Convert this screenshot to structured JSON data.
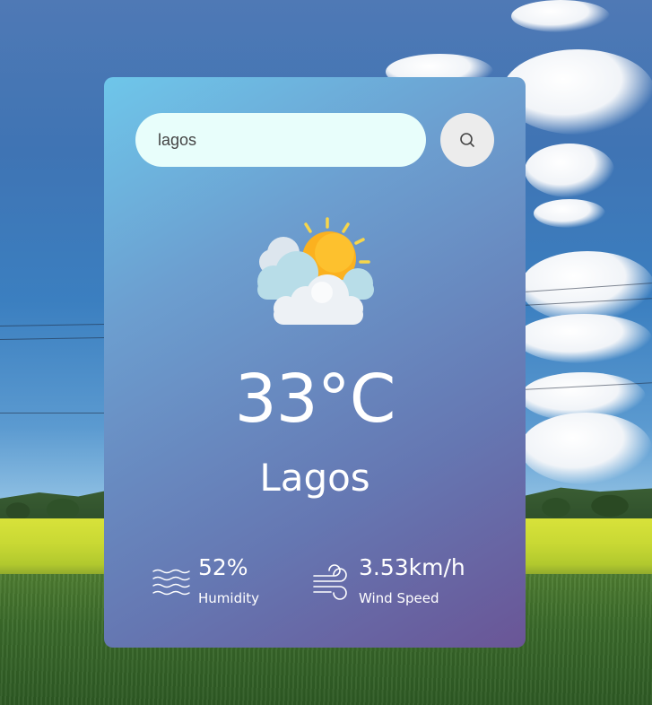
{
  "search": {
    "value": "lagos",
    "button_icon": "search-icon"
  },
  "weather": {
    "icon": "sun-behind-clouds-icon",
    "temperature": "33°C",
    "city": "Lagos"
  },
  "details": {
    "humidity": {
      "icon": "humidity-waves-icon",
      "value": "52%",
      "label": "Humidity"
    },
    "wind": {
      "icon": "wind-icon",
      "value": "3.53km/h",
      "label": "Wind Speed"
    }
  },
  "colors": {
    "card_gradient_start": "#6ec6ea",
    "card_gradient_end": "#6a5596",
    "search_bg": "#e8fefb",
    "search_button_bg": "#ececec",
    "text": "#ffffff"
  }
}
